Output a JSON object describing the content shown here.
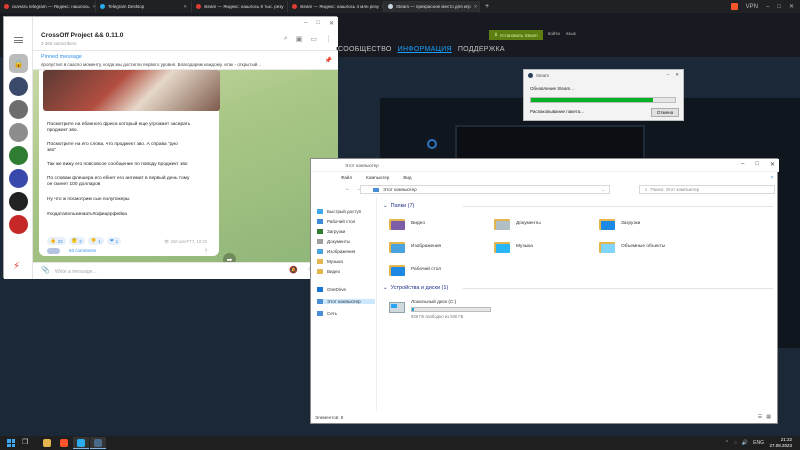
{
  "browser": {
    "tabs": [
      {
        "title": "скачать telegram — Яндекс: нашлось",
        "favicon_color": "#e53935",
        "active": false
      },
      {
        "title": "Telegram Desktop",
        "favicon_color": "#2aabee",
        "active": false
      },
      {
        "title": "steam — Яндекс: нашлось 8 тыс. резу",
        "favicon_color": "#e53935",
        "active": false
      },
      {
        "title": "steam — Яндекс: нашлось 4 млн резу",
        "favicon_color": "#e53935",
        "active": false
      },
      {
        "title": "Steam — прекрасное место для игр",
        "favicon_color": "#c6d4df",
        "active": true
      }
    ],
    "new_tab_glyph": "+",
    "vpn_label": "VPN",
    "window_controls": [
      "–",
      "□",
      "✕"
    ]
  },
  "steam": {
    "nav": [
      "СООБЩЕСТВО",
      "ИНФОРМАЦИЯ",
      "ПОДДЕРЖКА"
    ],
    "nav_active_index": 1,
    "install_button": "Установить Steam",
    "top_links": [
      "войти",
      "язык"
    ],
    "accent_color": "#1a9fff"
  },
  "steam_update": {
    "title": "Steam",
    "text": "Обновление Steam...",
    "progress": 0.85,
    "status": "Распаковывание пакета...",
    "cancel": "Отмена"
  },
  "telegram": {
    "channel_name": "CrossOff Project && 0.11.0",
    "subscribers": "3 360 subscribers",
    "pinned_title": "Pinned message",
    "pinned_text": "пропустил в сааспо моменту, когда мы достигли первого уровня. Благодарим каждому. итак - открытый...",
    "message_lines": [
      "Посмотрите на ебанного фриса который еще угрожает засирать",
      "проджект зво.",
      "Посмотрите на его слова, что проджект зво. А справа \"дно",
      "зво\"",
      "Так же вижу его повсовсое сообщение по поводу проджект зво",
      "По словам флешера его ебнет его антимит в первый день тому",
      "он скинет 100 долларов",
      "Ну что ж посмотрим сын полупокеры"
    ],
    "hashtags": "#ходатапельзинаать#офицерфейка",
    "reactions": [
      {
        "emoji": "👍",
        "count": "23"
      },
      {
        "emoji": "🤔",
        "count": "2"
      },
      {
        "emoji": "👎",
        "count": "1"
      },
      {
        "emoji": "❤",
        "count": "1"
      }
    ],
    "meta": "👁 258  azerFT7, 10:32",
    "comments": "63 comments",
    "input_placeholder": "Write a message...",
    "saved_glyph": "🔒",
    "avatar_colors": [
      "#3b4a6b",
      "#6d6d6d",
      "#8d8d8d",
      "#2e7d32",
      "#3949ab",
      "#222222",
      "#c62828"
    ]
  },
  "explorer": {
    "title": "Этот компьютер",
    "ribbon": [
      "Файл",
      "Компьютер",
      "Вид"
    ],
    "path": "Этот компьютер",
    "search_placeholder": "Поиск: Этот компьютер",
    "nav_items": [
      {
        "label": "Быстрый доступ",
        "color": "#3ea7f0"
      },
      {
        "label": "Рабочий стол",
        "color": "#3f8ad8"
      },
      {
        "label": "Загрузки",
        "color": "#2e7d32"
      },
      {
        "label": "Документы",
        "color": "#9e9e9e"
      },
      {
        "label": "Изображения",
        "color": "#4aa3df"
      },
      {
        "label": "Музыка",
        "color": "#e6b64e"
      },
      {
        "label": "Видео",
        "color": "#e6b64e"
      },
      {
        "label": "OneDrive",
        "color": "#1976d2"
      },
      {
        "label": "Этот компьютер",
        "color": "#4a8ed6"
      },
      {
        "label": "Сеть",
        "color": "#4a8ed6"
      }
    ],
    "nav_selected_index": 8,
    "folders_group": "Папки (7)",
    "folders": [
      {
        "label": "Видео",
        "color": "#7b5ea7"
      },
      {
        "label": "Документы",
        "color": "#b0bec5"
      },
      {
        "label": "Загрузки",
        "color": "#1e88e5"
      },
      {
        "label": "Изображения",
        "color": "#4aa3df"
      },
      {
        "label": "Музыка",
        "color": "#29b6f6"
      },
      {
        "label": "Объемные объекты",
        "color": "#81d4fa"
      },
      {
        "label": "Рабочий стол",
        "color": "#1e88e5"
      }
    ],
    "drives_group": "Устройства и диски (1)",
    "drive": {
      "name": "Локальный диск (C:)",
      "free": "928 ГБ свободно из 930 ГБ",
      "used_fraction": 0.02
    },
    "status": "Элементов: 8"
  },
  "taskbar": {
    "apps": [
      {
        "name": "explorer",
        "color": "#e6b64e"
      },
      {
        "name": "brave",
        "color": "#fb542b"
      },
      {
        "name": "telegram",
        "color": "#2aabee"
      },
      {
        "name": "steam",
        "color": "#4a6a8a"
      }
    ],
    "language": "ENG",
    "time": "21:22",
    "date": "27.08.2023"
  }
}
